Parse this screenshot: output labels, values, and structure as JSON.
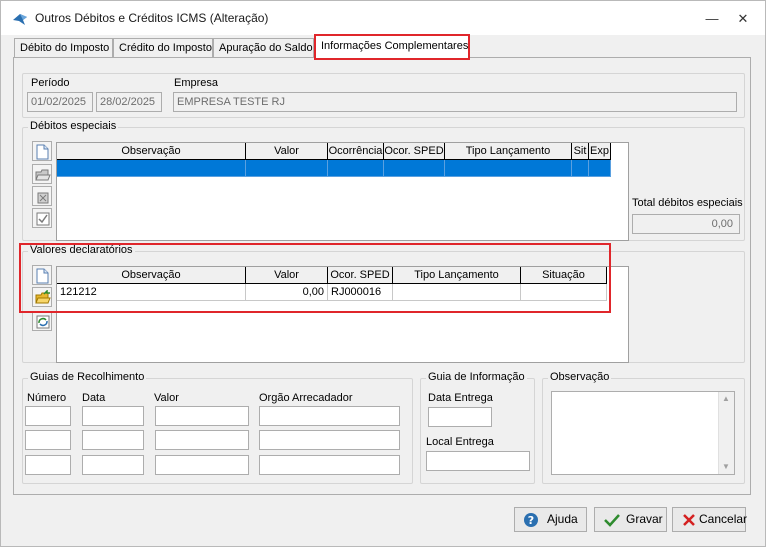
{
  "window": {
    "title": "Outros Débitos e Créditos ICMS (Alteração)",
    "minimize_glyph": "—",
    "close_glyph": "✕"
  },
  "tabs": [
    {
      "label": "Débito do Imposto"
    },
    {
      "label": "Crédito do Imposto"
    },
    {
      "label": "Apuração do Saldo"
    },
    {
      "label": "Informações Complementares",
      "active": true
    }
  ],
  "header": {
    "periodo_label": "Período",
    "periodo_inicio": "01/02/2025",
    "periodo_fim": "28/02/2025",
    "empresa_label": "Empresa",
    "empresa_value": "EMPRESA TESTE RJ"
  },
  "debitos_especiais": {
    "legend": "Débitos especiais",
    "columns": [
      "Observação",
      "Valor",
      "Ocorrência",
      "Ocor. SPED",
      "Tipo Lançamento",
      "Sit",
      "Exp"
    ],
    "total_label": "Total débitos especiais",
    "total_value": "0,00"
  },
  "valores_declaratorios": {
    "legend": "Valores declaratórios",
    "columns": [
      "Observação",
      "Valor",
      "Ocor. SPED",
      "Tipo Lançamento",
      "Situação"
    ],
    "rows": [
      {
        "observacao": "121212",
        "valor": "0,00",
        "ocor_sped": "RJ000016",
        "tipo": "",
        "situacao": ""
      }
    ]
  },
  "guias_recolhimento": {
    "legend": "Guias de Recolhimento",
    "col_numero": "Número",
    "col_data": "Data",
    "col_valor": "Valor",
    "col_orgao": "Orgão Arrecadador"
  },
  "guia_informacao": {
    "legend": "Guia de Informação",
    "data_entrega_label": "Data Entrega",
    "local_entrega_label": "Local Entrega"
  },
  "observacao": {
    "legend": "Observação"
  },
  "buttons": {
    "ajuda": "Ajuda",
    "gravar": "Gravar",
    "cancelar": "Cancelar"
  },
  "colors": {
    "selection": "#0078d7",
    "highlight": "#e0262b"
  },
  "icons": {
    "app": "app-icon",
    "new": "new-document-icon",
    "open": "open-folder-icon",
    "delete": "delete-icon",
    "check": "checklist-icon",
    "refresh": "refresh-icon",
    "help": "help-icon",
    "save": "checkmark-icon",
    "cancel": "cancel-x-icon"
  }
}
